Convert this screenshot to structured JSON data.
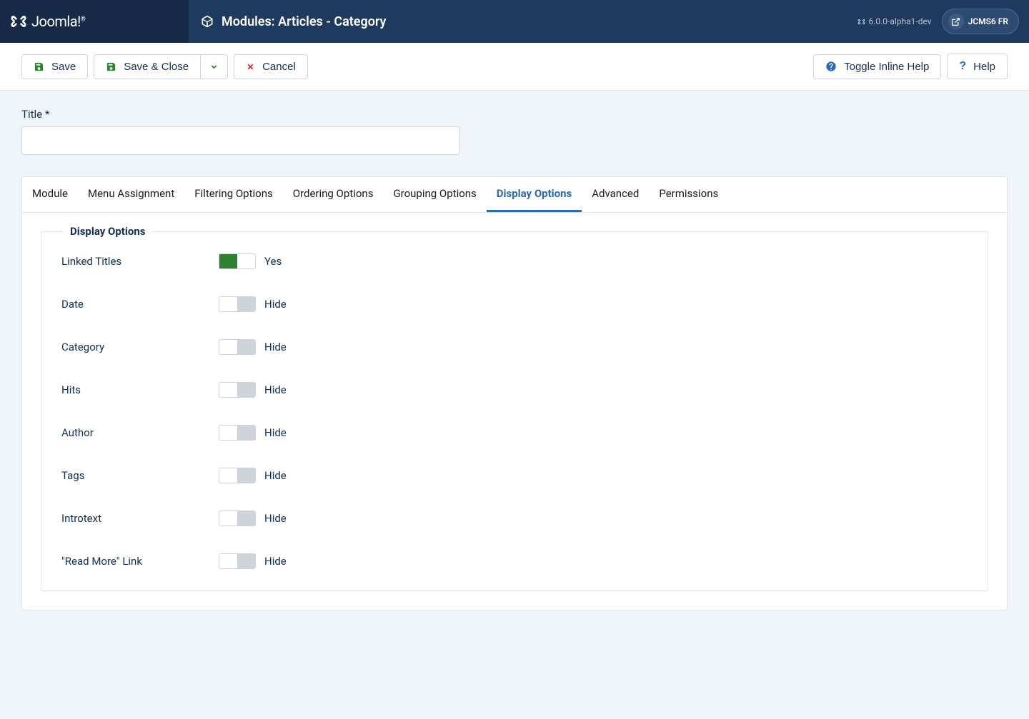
{
  "header": {
    "logo_text": "Joomla!",
    "page_title": "Modules: Articles - Category",
    "version": "6.0.0-alpha1-dev",
    "site_link_label": "JCMS6 FR"
  },
  "toolbar": {
    "save": "Save",
    "save_close": "Save & Close",
    "cancel": "Cancel",
    "toggle_help": "Toggle Inline Help",
    "help": "Help"
  },
  "form": {
    "title_label": "Title *",
    "title_value": ""
  },
  "tabs": [
    {
      "label": "Module",
      "active": false
    },
    {
      "label": "Menu Assignment",
      "active": false
    },
    {
      "label": "Filtering Options",
      "active": false
    },
    {
      "label": "Ordering Options",
      "active": false
    },
    {
      "label": "Grouping Options",
      "active": false
    },
    {
      "label": "Display Options",
      "active": true
    },
    {
      "label": "Advanced",
      "active": false
    },
    {
      "label": "Permissions",
      "active": false
    }
  ],
  "display_options": {
    "legend": "Display Options",
    "fields": [
      {
        "label": "Linked Titles",
        "value": true,
        "text": "Yes"
      },
      {
        "label": "Date",
        "value": false,
        "text": "Hide"
      },
      {
        "label": "Category",
        "value": false,
        "text": "Hide"
      },
      {
        "label": "Hits",
        "value": false,
        "text": "Hide"
      },
      {
        "label": "Author",
        "value": false,
        "text": "Hide"
      },
      {
        "label": "Tags",
        "value": false,
        "text": "Hide"
      },
      {
        "label": "Introtext",
        "value": false,
        "text": "Hide"
      },
      {
        "label": "\"Read More\" Link",
        "value": false,
        "text": "Hide"
      }
    ]
  }
}
